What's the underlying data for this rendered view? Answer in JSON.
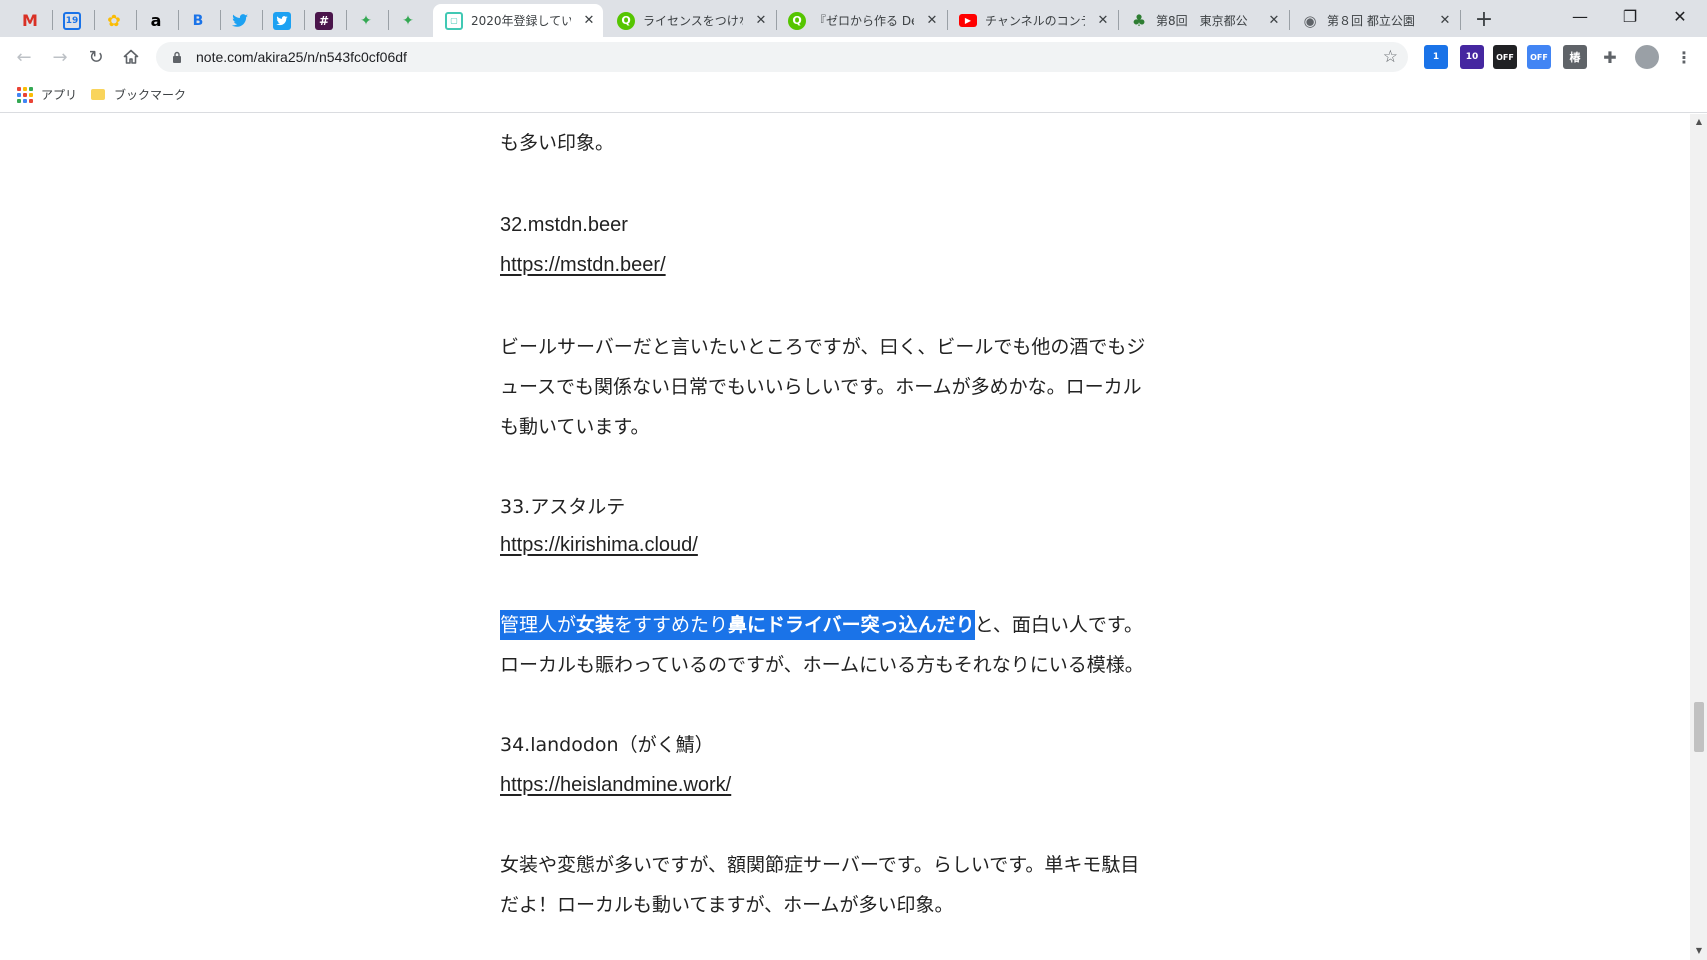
{
  "browser": {
    "pinned_tabs": [
      {
        "icon": "gmail-icon",
        "glyph": "M",
        "color": "#d93025"
      },
      {
        "icon": "calendar-icon",
        "glyph": "19",
        "color": "#1a73e8"
      },
      {
        "icon": "photos-icon",
        "glyph": "✿",
        "color": "#fbbc04"
      },
      {
        "icon": "amazon-icon",
        "glyph": "a",
        "color": "#000000"
      },
      {
        "icon": "hatena-icon",
        "glyph": "B",
        "color": "#1a73e8"
      },
      {
        "icon": "twitter-icon",
        "glyph": "🐦",
        "color": "#1da1f2"
      },
      {
        "icon": "twitter-box-icon",
        "glyph": "t",
        "color": "#1da1f2"
      },
      {
        "icon": "slack-icon",
        "glyph": "#",
        "color": "#4a154b"
      },
      {
        "icon": "pinwheel-icon",
        "glyph": "✦",
        "color": "#34a853"
      },
      {
        "icon": "pinwheel-icon-2",
        "glyph": "✦",
        "color": "#34a853"
      }
    ],
    "tabs": [
      {
        "title": "2020年登録してい",
        "icon": "note-icon",
        "glyph": "▢",
        "color": "#41c9b4",
        "active": true
      },
      {
        "title": "ライセンスをつけな",
        "icon": "qiita-icon",
        "glyph": "Q",
        "color": "#55c500",
        "active": false
      },
      {
        "title": "『ゼロから作る Dee",
        "icon": "qiita-icon",
        "glyph": "Q",
        "color": "#55c500",
        "active": false
      },
      {
        "title": "チャンネルのコンテン",
        "icon": "youtube-icon",
        "glyph": "▶",
        "color": "#ff0000",
        "active": false
      },
      {
        "title": "第8回　東京都公",
        "icon": "park-icon",
        "glyph": "♣",
        "color": "#2e7d32",
        "active": false
      },
      {
        "title": "第８回 都立公園",
        "icon": "globe-icon",
        "glyph": "◉",
        "color": "#5f6368",
        "active": false
      }
    ],
    "url": "note.com/akira25/n/n543fc0cf06df",
    "bookmarks": [
      {
        "label": "アプリ"
      },
      {
        "label": "ブックマーク"
      }
    ],
    "extensions": [
      {
        "name": "extension-1-icon",
        "text": "1",
        "color": "#1a73e8"
      },
      {
        "name": "extension-10-icon",
        "text": "10",
        "color": "#4527a0"
      },
      {
        "name": "extension-off-icon",
        "text": "OFF",
        "color": "#202124"
      },
      {
        "name": "extension-m-off-icon",
        "text": "OFF",
        "color": "#4285f4"
      },
      {
        "name": "extension-kanji-icon",
        "text": "椿",
        "color": "#5f6368"
      }
    ]
  },
  "article": {
    "lines": [
      "も多い印象。",
      "32.mstdn.beer",
      "https://mstdn.beer/",
      "ビールサーバーだと言いたいところですが、曰く、ビールでも他の酒でもジ",
      "ュースでも関係ない日常でもいいらしいです。ホームが多めかな。ローカル",
      "も動いています。",
      "33.アスタルテ",
      "https://kirishima.cloud/",
      "ローカルも賑わっているのですが、ホームにいる方もそれなりにいる模様。",
      "34.landodon（がく鯖）",
      "https://heislandmine.work/",
      "女装や変態が多いですが、額関節症サーバーです。らしいです。単キモ駄目",
      "だよ！ローカルも動いてますが、ホームが多い印象。"
    ],
    "highlight_parts": [
      "管理人が",
      "女装",
      "をすすめたり",
      "鼻にドライバー突っ込んだり"
    ],
    "after_highlight": "と、面白い人です。"
  }
}
